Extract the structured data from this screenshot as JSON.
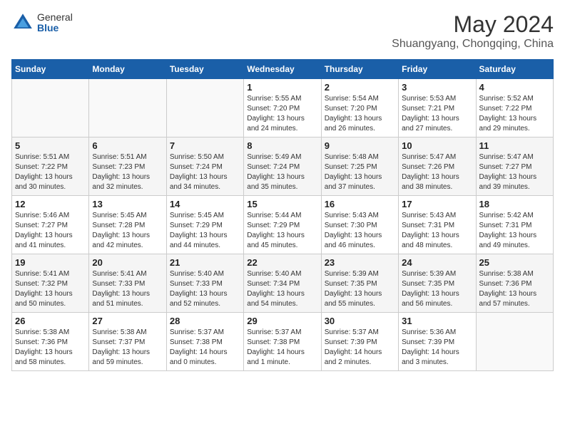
{
  "header": {
    "logo_general": "General",
    "logo_blue": "Blue",
    "month": "May 2024",
    "location": "Shuangyang, Chongqing, China"
  },
  "weekdays": [
    "Sunday",
    "Monday",
    "Tuesday",
    "Wednesday",
    "Thursday",
    "Friday",
    "Saturday"
  ],
  "weeks": [
    [
      {
        "day": "",
        "info": ""
      },
      {
        "day": "",
        "info": ""
      },
      {
        "day": "",
        "info": ""
      },
      {
        "day": "1",
        "info": "Sunrise: 5:55 AM\nSunset: 7:20 PM\nDaylight: 13 hours\nand 24 minutes."
      },
      {
        "day": "2",
        "info": "Sunrise: 5:54 AM\nSunset: 7:20 PM\nDaylight: 13 hours\nand 26 minutes."
      },
      {
        "day": "3",
        "info": "Sunrise: 5:53 AM\nSunset: 7:21 PM\nDaylight: 13 hours\nand 27 minutes."
      },
      {
        "day": "4",
        "info": "Sunrise: 5:52 AM\nSunset: 7:22 PM\nDaylight: 13 hours\nand 29 minutes."
      }
    ],
    [
      {
        "day": "5",
        "info": "Sunrise: 5:51 AM\nSunset: 7:22 PM\nDaylight: 13 hours\nand 30 minutes."
      },
      {
        "day": "6",
        "info": "Sunrise: 5:51 AM\nSunset: 7:23 PM\nDaylight: 13 hours\nand 32 minutes."
      },
      {
        "day": "7",
        "info": "Sunrise: 5:50 AM\nSunset: 7:24 PM\nDaylight: 13 hours\nand 34 minutes."
      },
      {
        "day": "8",
        "info": "Sunrise: 5:49 AM\nSunset: 7:24 PM\nDaylight: 13 hours\nand 35 minutes."
      },
      {
        "day": "9",
        "info": "Sunrise: 5:48 AM\nSunset: 7:25 PM\nDaylight: 13 hours\nand 37 minutes."
      },
      {
        "day": "10",
        "info": "Sunrise: 5:47 AM\nSunset: 7:26 PM\nDaylight: 13 hours\nand 38 minutes."
      },
      {
        "day": "11",
        "info": "Sunrise: 5:47 AM\nSunset: 7:27 PM\nDaylight: 13 hours\nand 39 minutes."
      }
    ],
    [
      {
        "day": "12",
        "info": "Sunrise: 5:46 AM\nSunset: 7:27 PM\nDaylight: 13 hours\nand 41 minutes."
      },
      {
        "day": "13",
        "info": "Sunrise: 5:45 AM\nSunset: 7:28 PM\nDaylight: 13 hours\nand 42 minutes."
      },
      {
        "day": "14",
        "info": "Sunrise: 5:45 AM\nSunset: 7:29 PM\nDaylight: 13 hours\nand 44 minutes."
      },
      {
        "day": "15",
        "info": "Sunrise: 5:44 AM\nSunset: 7:29 PM\nDaylight: 13 hours\nand 45 minutes."
      },
      {
        "day": "16",
        "info": "Sunrise: 5:43 AM\nSunset: 7:30 PM\nDaylight: 13 hours\nand 46 minutes."
      },
      {
        "day": "17",
        "info": "Sunrise: 5:43 AM\nSunset: 7:31 PM\nDaylight: 13 hours\nand 48 minutes."
      },
      {
        "day": "18",
        "info": "Sunrise: 5:42 AM\nSunset: 7:31 PM\nDaylight: 13 hours\nand 49 minutes."
      }
    ],
    [
      {
        "day": "19",
        "info": "Sunrise: 5:41 AM\nSunset: 7:32 PM\nDaylight: 13 hours\nand 50 minutes."
      },
      {
        "day": "20",
        "info": "Sunrise: 5:41 AM\nSunset: 7:33 PM\nDaylight: 13 hours\nand 51 minutes."
      },
      {
        "day": "21",
        "info": "Sunrise: 5:40 AM\nSunset: 7:33 PM\nDaylight: 13 hours\nand 52 minutes."
      },
      {
        "day": "22",
        "info": "Sunrise: 5:40 AM\nSunset: 7:34 PM\nDaylight: 13 hours\nand 54 minutes."
      },
      {
        "day": "23",
        "info": "Sunrise: 5:39 AM\nSunset: 7:35 PM\nDaylight: 13 hours\nand 55 minutes."
      },
      {
        "day": "24",
        "info": "Sunrise: 5:39 AM\nSunset: 7:35 PM\nDaylight: 13 hours\nand 56 minutes."
      },
      {
        "day": "25",
        "info": "Sunrise: 5:38 AM\nSunset: 7:36 PM\nDaylight: 13 hours\nand 57 minutes."
      }
    ],
    [
      {
        "day": "26",
        "info": "Sunrise: 5:38 AM\nSunset: 7:36 PM\nDaylight: 13 hours\nand 58 minutes."
      },
      {
        "day": "27",
        "info": "Sunrise: 5:38 AM\nSunset: 7:37 PM\nDaylight: 13 hours\nand 59 minutes."
      },
      {
        "day": "28",
        "info": "Sunrise: 5:37 AM\nSunset: 7:38 PM\nDaylight: 14 hours\nand 0 minutes."
      },
      {
        "day": "29",
        "info": "Sunrise: 5:37 AM\nSunset: 7:38 PM\nDaylight: 14 hours\nand 1 minute."
      },
      {
        "day": "30",
        "info": "Sunrise: 5:37 AM\nSunset: 7:39 PM\nDaylight: 14 hours\nand 2 minutes."
      },
      {
        "day": "31",
        "info": "Sunrise: 5:36 AM\nSunset: 7:39 PM\nDaylight: 14 hours\nand 3 minutes."
      },
      {
        "day": "",
        "info": ""
      }
    ]
  ]
}
